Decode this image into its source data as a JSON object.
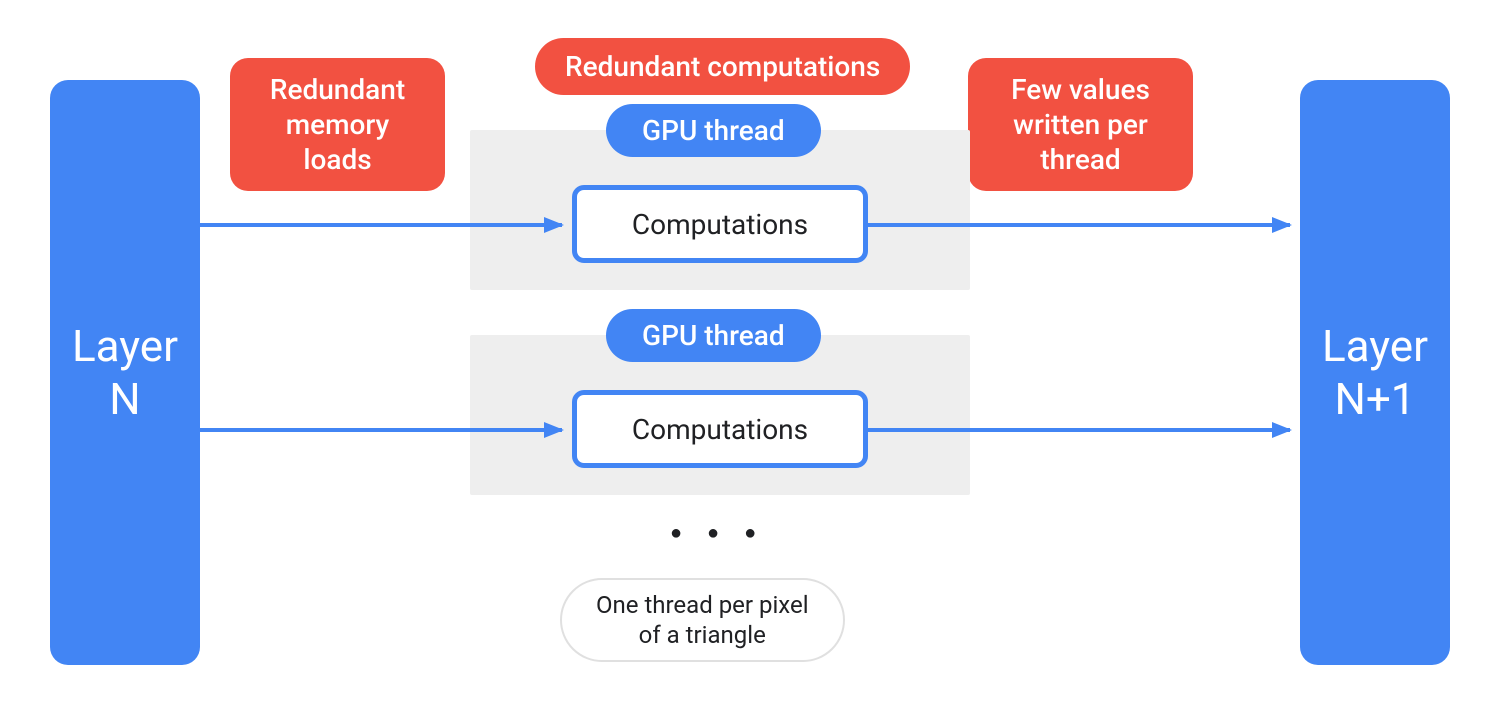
{
  "colors": {
    "blue": "#4285F4",
    "red": "#F25141",
    "grey": "#EEEEEE"
  },
  "layer_left": {
    "line1": "Layer",
    "line2": "N"
  },
  "layer_right": {
    "line1": "Layer",
    "line2": "N+1"
  },
  "callouts": {
    "redundant_memory": {
      "line1": "Redundant",
      "line2": "memory",
      "line3": "loads"
    },
    "redundant_comp": "Redundant computations",
    "few_values": {
      "line1": "Few values",
      "line2": "written per",
      "line3": "thread"
    }
  },
  "threads": {
    "label": "GPU thread",
    "box": "Computations"
  },
  "ellipsis": "● ● ●",
  "footer": {
    "line1": "One thread per pixel",
    "line2": "of a triangle"
  }
}
